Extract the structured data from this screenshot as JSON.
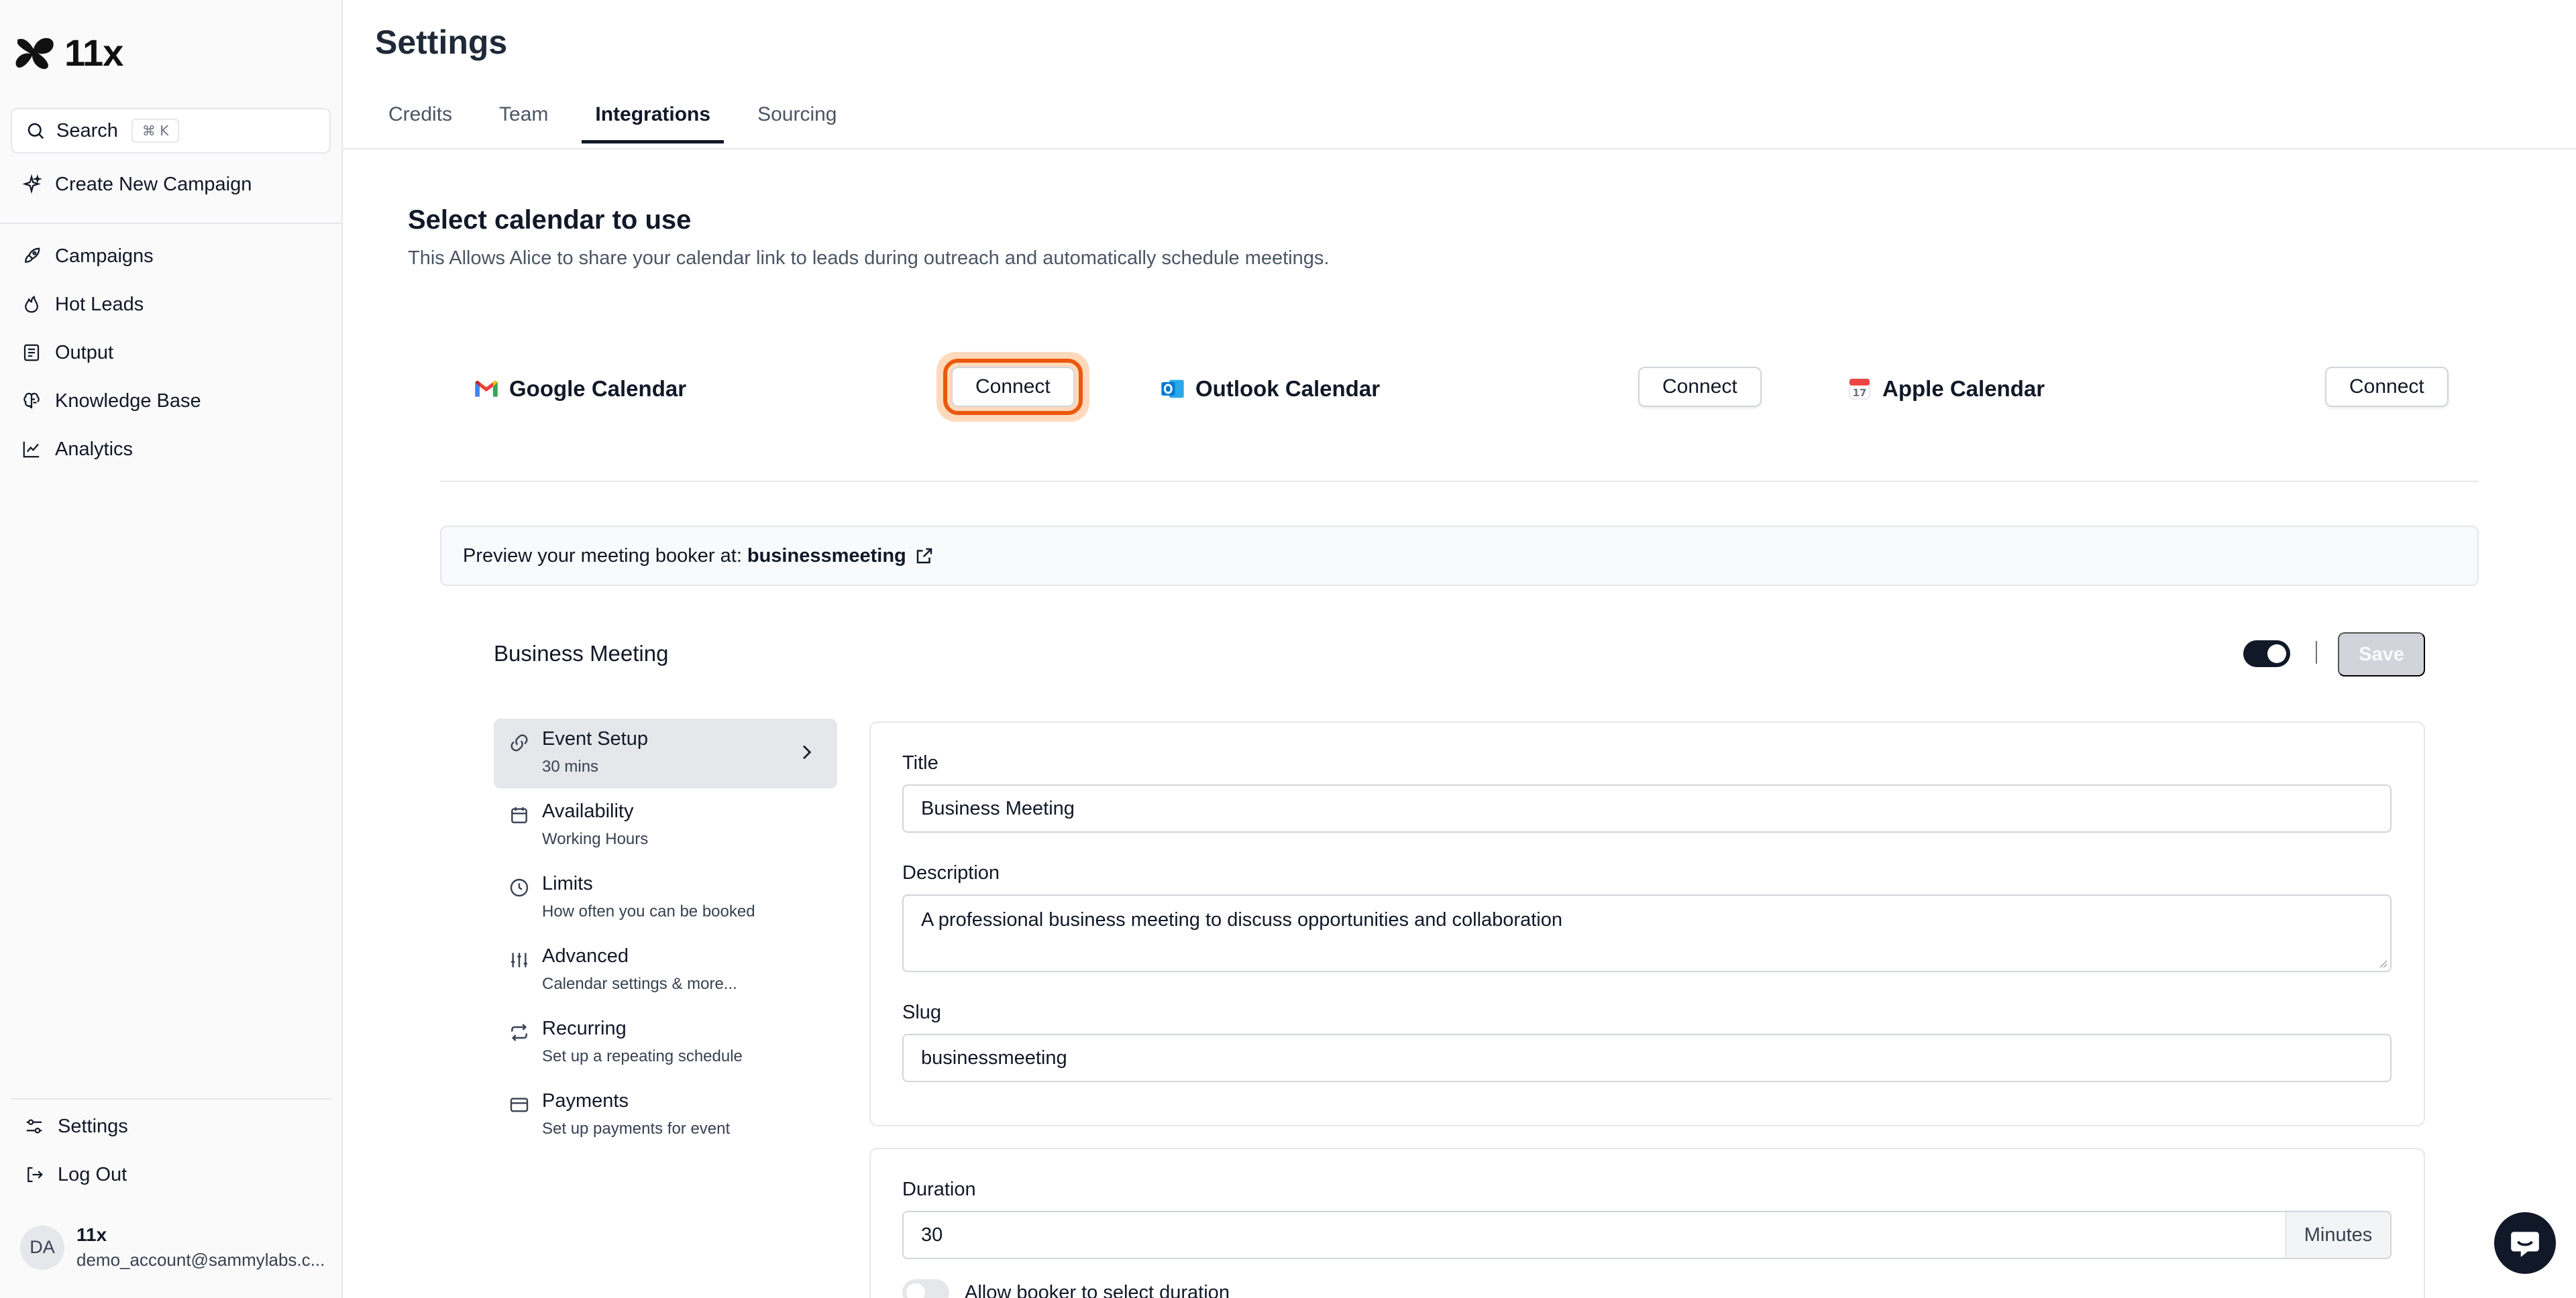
{
  "app": {
    "logo_text": "11x"
  },
  "sidebar": {
    "search_label": "Search",
    "search_shortcut": "⌘ K",
    "create_campaign": "Create New Campaign",
    "nav": [
      {
        "label": "Campaigns",
        "icon": "rocket-icon"
      },
      {
        "label": "Hot Leads",
        "icon": "flame-icon"
      },
      {
        "label": "Output",
        "icon": "document-icon"
      },
      {
        "label": "Knowledge Base",
        "icon": "brain-icon"
      },
      {
        "label": "Analytics",
        "icon": "chart-line-icon"
      }
    ],
    "settings": "Settings",
    "logout": "Log Out",
    "user": {
      "initials": "DA",
      "name": "11x",
      "email": "demo_account@sammylabs.c..."
    }
  },
  "header": {
    "title": "Settings",
    "tabs": [
      {
        "label": "Credits"
      },
      {
        "label": "Team"
      },
      {
        "label": "Integrations",
        "active": true
      },
      {
        "label": "Sourcing"
      }
    ]
  },
  "calendar": {
    "title": "Select calendar to use",
    "description": "This Allows Alice to share your calendar link to leads during outreach and automatically schedule meetings.",
    "providers": [
      {
        "name": "Google Calendar",
        "button": "Connect",
        "icon": "gmail-icon"
      },
      {
        "name": "Outlook Calendar",
        "button": "Connect",
        "icon": "outlook-icon"
      },
      {
        "name": "Apple Calendar",
        "button": "Connect",
        "icon": "apple-calendar-icon"
      }
    ],
    "apple_icon_day": "17"
  },
  "preview": {
    "prefix": "Preview your meeting booker at:",
    "slug": "businessmeeting"
  },
  "event": {
    "name": "Business Meeting",
    "save_label": "Save",
    "menu": [
      {
        "title": "Event Setup",
        "subtitle": "30 mins"
      },
      {
        "title": "Availability",
        "subtitle": "Working Hours"
      },
      {
        "title": "Limits",
        "subtitle": "How often you can be booked"
      },
      {
        "title": "Advanced",
        "subtitle": "Calendar settings & more..."
      },
      {
        "title": "Recurring",
        "subtitle": "Set up a repeating schedule"
      },
      {
        "title": "Payments",
        "subtitle": "Set up payments for event"
      }
    ],
    "form": {
      "title_label": "Title",
      "title_value": "Business Meeting",
      "description_label": "Description",
      "description_value": "A professional business meeting to discuss opportunities and collaboration",
      "slug_label": "Slug",
      "slug_value": "businessmeeting",
      "duration_label": "Duration",
      "duration_value": "30",
      "duration_unit": "Minutes",
      "allow_duration_label": "Allow booker to select duration"
    }
  },
  "colors": {
    "accent": "#111827",
    "highlight": "#ea580c"
  }
}
